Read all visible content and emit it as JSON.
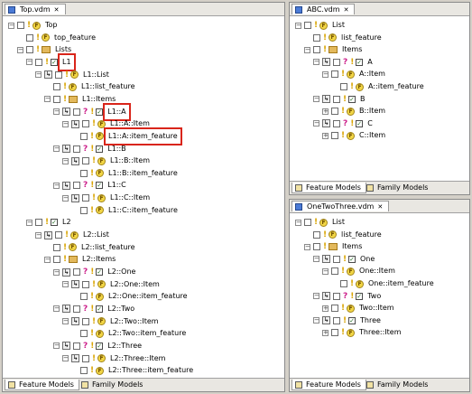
{
  "top_panel": {
    "tab_title": "Top.vdm",
    "bottom_tabs": [
      "Feature Models",
      "Family Models"
    ],
    "rows": [
      {
        "label": "Top",
        "indent": 1,
        "expander": "minus",
        "icon": "feature"
      },
      {
        "label": "top_feature",
        "indent": 2,
        "expander": "none",
        "icon": "feature"
      },
      {
        "label": "Lists",
        "indent": 2,
        "expander": "minus",
        "icon": "folder"
      },
      {
        "label": "L1",
        "indent": 3,
        "expander": "minus",
        "icon": "check",
        "highlight": true
      },
      {
        "label": "L1::List",
        "indent": 4,
        "expander": "minus",
        "icon": "feature",
        "grp": true
      },
      {
        "label": "L1::list_feature",
        "indent": 5,
        "expander": "none",
        "icon": "feature"
      },
      {
        "label": "L1::Items",
        "indent": 5,
        "expander": "minus",
        "icon": "folder"
      },
      {
        "label": "L1::A",
        "indent": 6,
        "expander": "minus",
        "icon": "check",
        "q": true,
        "grp": true,
        "highlight": true
      },
      {
        "label": "L1::A::Item",
        "indent": 7,
        "expander": "minus",
        "icon": "feature",
        "grp": true
      },
      {
        "label": "L1::A::item_feature",
        "indent": 8,
        "expander": "none",
        "icon": "feature",
        "highlight": true
      },
      {
        "label": "L1::B",
        "indent": 6,
        "expander": "minus",
        "icon": "check",
        "q": true,
        "grp": true
      },
      {
        "label": "L1::B::Item",
        "indent": 7,
        "expander": "minus",
        "icon": "feature",
        "grp": true
      },
      {
        "label": "L1::B::item_feature",
        "indent": 8,
        "expander": "none",
        "icon": "feature"
      },
      {
        "label": "L1::C",
        "indent": 6,
        "expander": "minus",
        "icon": "check",
        "q": true,
        "grp": true
      },
      {
        "label": "L1::C::Item",
        "indent": 7,
        "expander": "minus",
        "icon": "feature",
        "grp": true
      },
      {
        "label": "L1::C::item_feature",
        "indent": 8,
        "expander": "none",
        "icon": "feature"
      },
      {
        "label": "L2",
        "indent": 3,
        "expander": "minus",
        "icon": "check"
      },
      {
        "label": "L2::List",
        "indent": 4,
        "expander": "minus",
        "icon": "feature",
        "grp": true
      },
      {
        "label": "L2::list_feature",
        "indent": 5,
        "expander": "none",
        "icon": "feature"
      },
      {
        "label": "L2::Items",
        "indent": 5,
        "expander": "minus",
        "icon": "folder"
      },
      {
        "label": "L2::One",
        "indent": 6,
        "expander": "minus",
        "icon": "check",
        "q": true,
        "grp": true
      },
      {
        "label": "L2::One::Item",
        "indent": 7,
        "expander": "minus",
        "icon": "feature",
        "grp": true
      },
      {
        "label": "L2::One::item_feature",
        "indent": 8,
        "expander": "none",
        "icon": "feature"
      },
      {
        "label": "L2::Two",
        "indent": 6,
        "expander": "minus",
        "icon": "check",
        "q": true,
        "grp": true
      },
      {
        "label": "L2::Two::Item",
        "indent": 7,
        "expander": "minus",
        "icon": "feature",
        "grp": true
      },
      {
        "label": "L2::Two::item_feature",
        "indent": 8,
        "expander": "none",
        "icon": "feature"
      },
      {
        "label": "L2::Three",
        "indent": 6,
        "expander": "minus",
        "icon": "check",
        "q": true,
        "grp": true
      },
      {
        "label": "L2::Three::Item",
        "indent": 7,
        "expander": "minus",
        "icon": "feature",
        "grp": true
      },
      {
        "label": "L2::Three::item_feature",
        "indent": 8,
        "expander": "none",
        "icon": "feature"
      }
    ]
  },
  "abc_panel": {
    "tab_title": "ABC.vdm",
    "bottom_tabs": [
      "Feature Models",
      "Family Models"
    ],
    "rows": [
      {
        "label": "List",
        "indent": 1,
        "expander": "minus",
        "icon": "feature"
      },
      {
        "label": "list_feature",
        "indent": 2,
        "expander": "none",
        "icon": "feature"
      },
      {
        "label": "Items",
        "indent": 2,
        "expander": "minus",
        "icon": "folder"
      },
      {
        "label": "A",
        "indent": 3,
        "expander": "minus",
        "icon": "check",
        "q": true,
        "grp": true
      },
      {
        "label": "A::Item",
        "indent": 4,
        "expander": "minus",
        "icon": "feature"
      },
      {
        "label": "A::item_feature",
        "indent": 5,
        "expander": "none",
        "icon": "feature"
      },
      {
        "label": "B",
        "indent": 3,
        "expander": "minus",
        "icon": "check",
        "grp": true
      },
      {
        "label": "B::Item",
        "indent": 4,
        "expander": "plus",
        "icon": "feature"
      },
      {
        "label": "C",
        "indent": 3,
        "expander": "minus",
        "icon": "check",
        "q": true,
        "grp": true
      },
      {
        "label": "C::Item",
        "indent": 4,
        "expander": "plus",
        "icon": "feature"
      }
    ]
  },
  "onetwothree_panel": {
    "tab_title": "OneTwoThree.vdm",
    "bottom_tabs": [
      "Feature Models",
      "Family Models"
    ],
    "rows": [
      {
        "label": "List",
        "indent": 1,
        "expander": "minus",
        "icon": "feature"
      },
      {
        "label": "list_feature",
        "indent": 2,
        "expander": "none",
        "icon": "feature"
      },
      {
        "label": "Items",
        "indent": 2,
        "expander": "minus",
        "icon": "folder"
      },
      {
        "label": "One",
        "indent": 3,
        "expander": "minus",
        "icon": "check",
        "grp": true
      },
      {
        "label": "One::Item",
        "indent": 4,
        "expander": "minus",
        "icon": "feature"
      },
      {
        "label": "One::item_feature",
        "indent": 5,
        "expander": "none",
        "icon": "feature"
      },
      {
        "label": "Two",
        "indent": 3,
        "expander": "minus",
        "icon": "check",
        "q": true,
        "grp": true
      },
      {
        "label": "Two::Item",
        "indent": 4,
        "expander": "plus",
        "icon": "feature"
      },
      {
        "label": "Three",
        "indent": 3,
        "expander": "minus",
        "icon": "check",
        "grp": true
      },
      {
        "label": "Three::Item",
        "indent": 4,
        "expander": "plus",
        "icon": "feature"
      }
    ]
  },
  "icons": {
    "feature": "feature-icon",
    "folder": "folder-icon",
    "check": "checked-feature-icon",
    "grp": "group-icon",
    "q": "question-mark-icon"
  },
  "colors": {
    "highlight": "#d9251a",
    "feature": "#f2d646",
    "question": "#cc1f8a",
    "exclaim": "#d9a400"
  }
}
